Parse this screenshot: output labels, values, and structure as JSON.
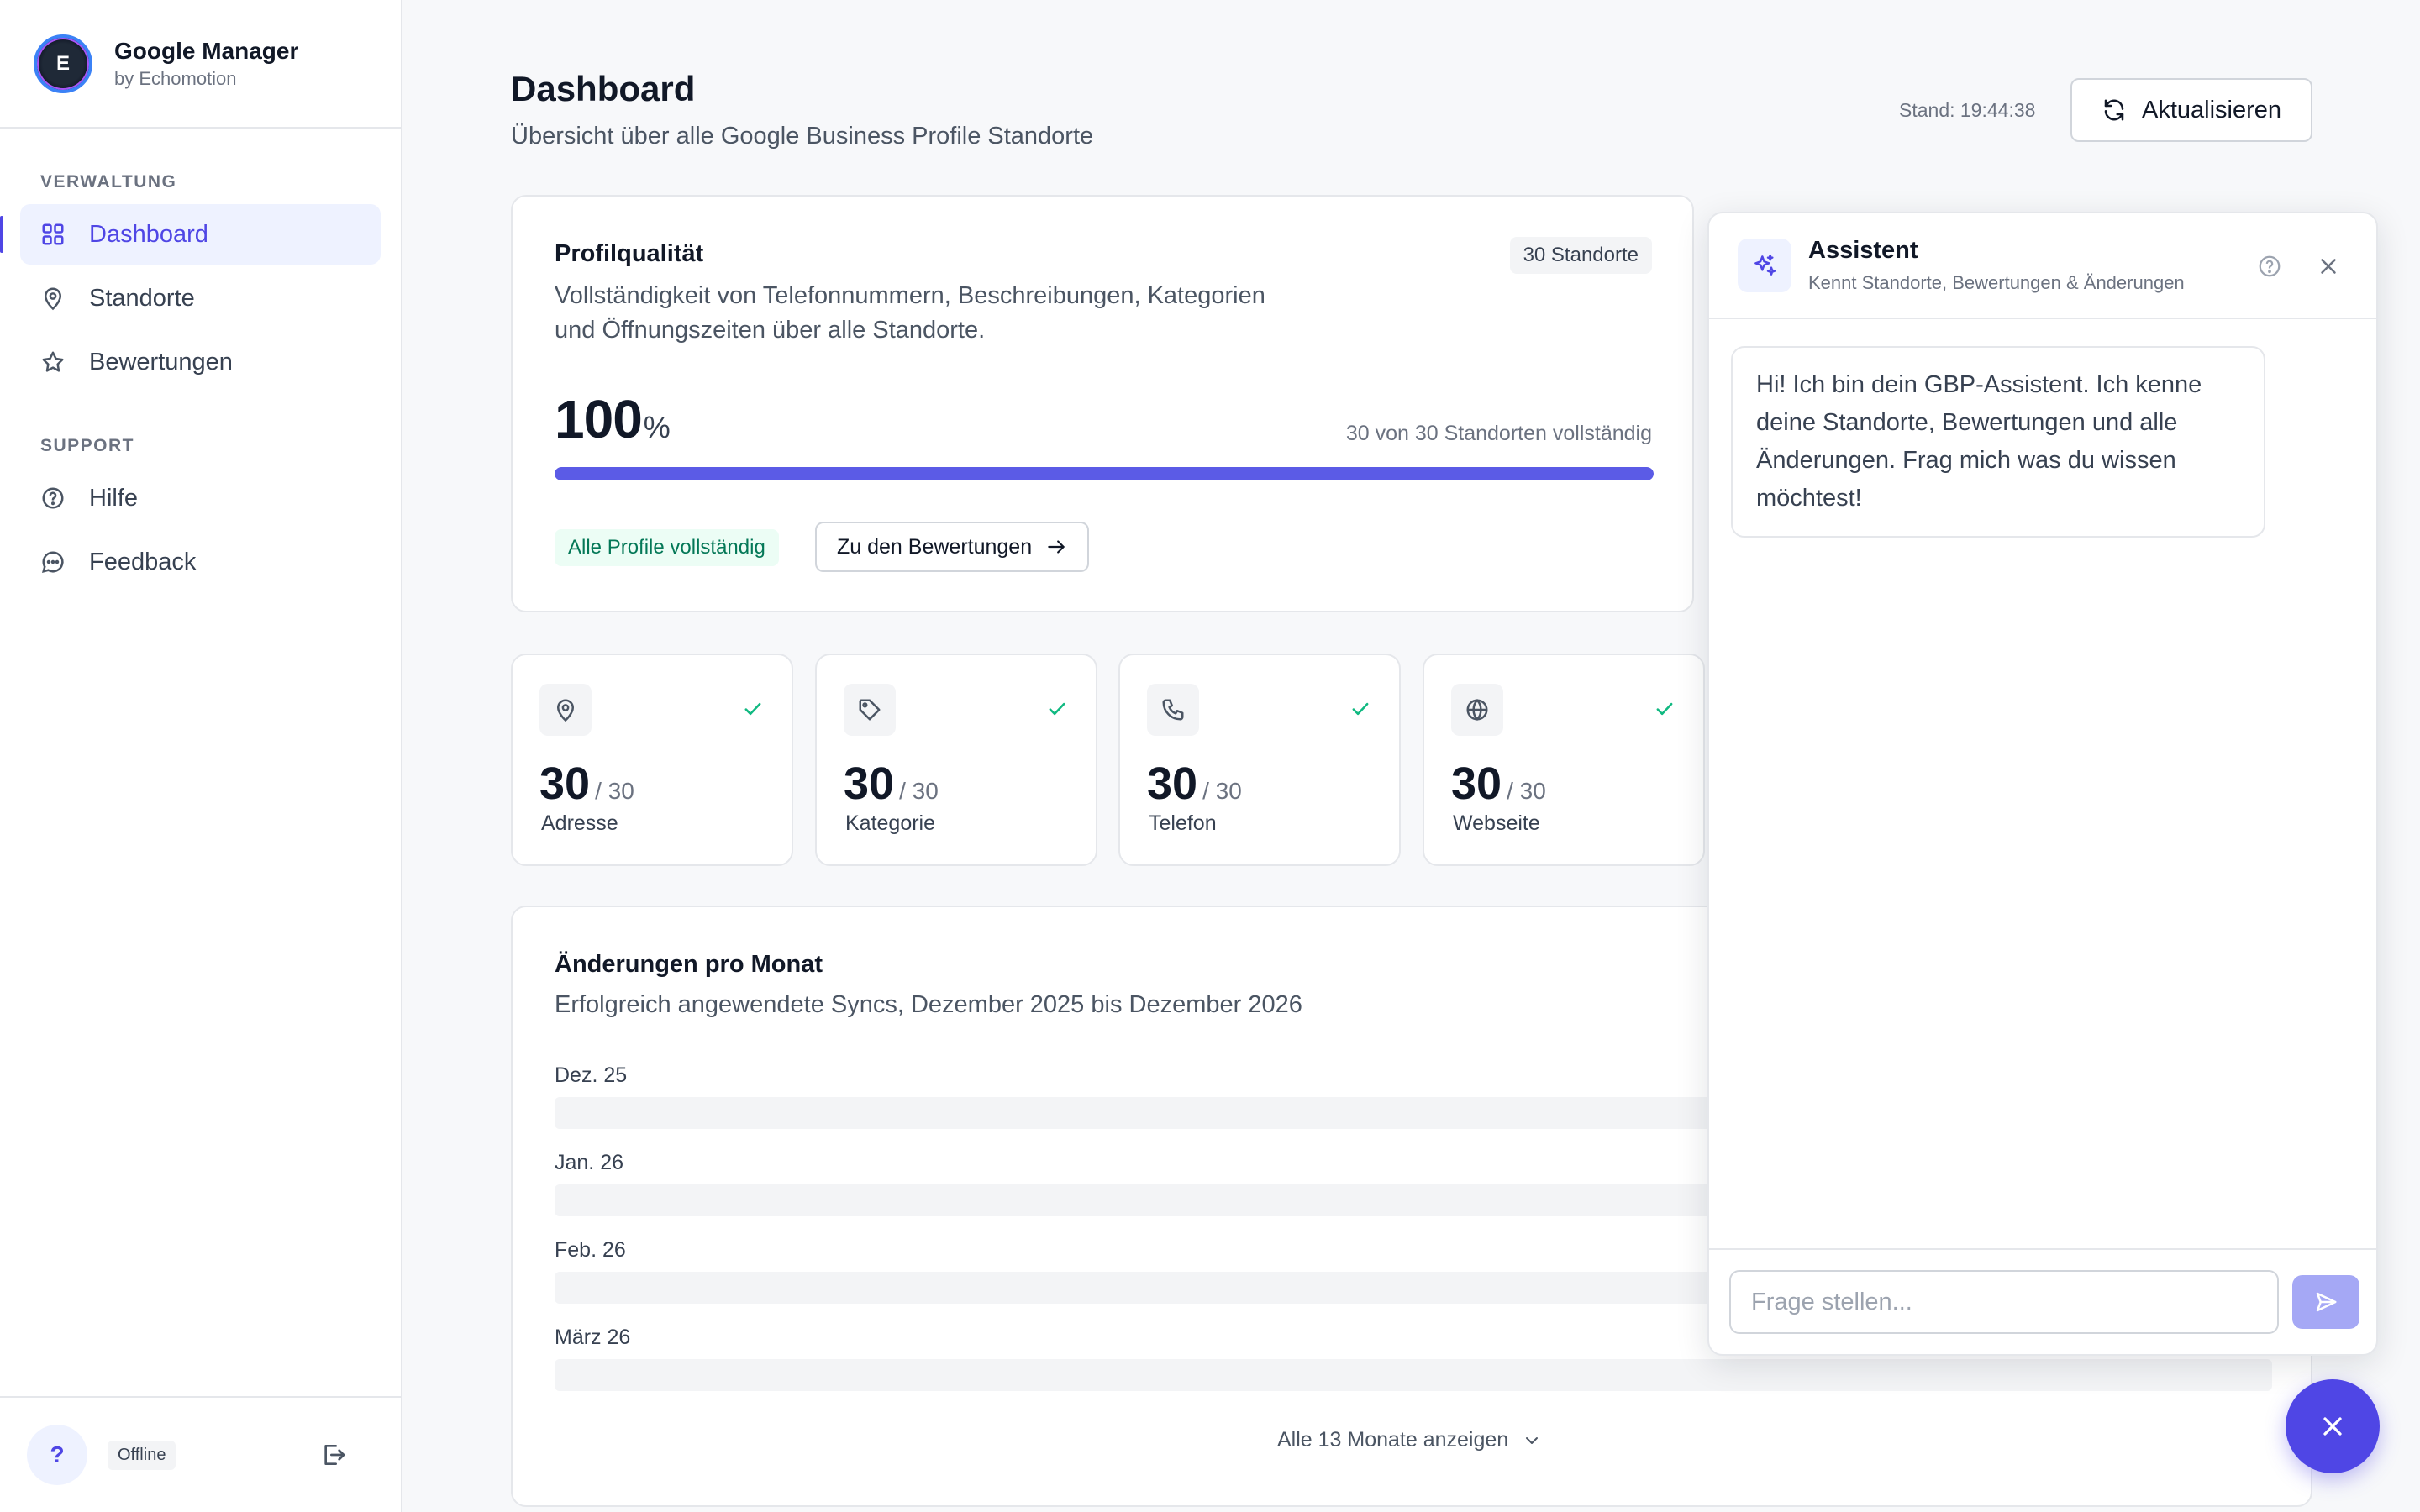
{
  "brand": {
    "title": "Google Manager",
    "subtitle": "by Echomotion",
    "logo_letter": "E"
  },
  "sidebar": {
    "sections": [
      {
        "heading": "VERWALTUNG",
        "items": [
          {
            "label": "Dashboard",
            "icon": "grid-icon",
            "active": true
          },
          {
            "label": "Standorte",
            "icon": "map-pin-icon"
          },
          {
            "label": "Bewertungen",
            "icon": "star-icon"
          }
        ]
      },
      {
        "heading": "SUPPORT",
        "items": [
          {
            "label": "Hilfe",
            "icon": "help-circle-icon"
          },
          {
            "label": "Feedback",
            "icon": "message-icon"
          }
        ]
      }
    ],
    "footer": {
      "help_glyph": "?",
      "status": "Offline"
    }
  },
  "header": {
    "title": "Dashboard",
    "subtitle": "Übersicht über alle Google Business Profile Standorte",
    "stand": "Stand: 19:44:38",
    "refresh_label": "Aktualisieren"
  },
  "profile_quality": {
    "title": "Profilqualität",
    "badge": "30 Standorte",
    "description": "Vollständigkeit von Telefonnummern, Beschreibungen, Kategorien und Öffnungszeiten über alle Standorte.",
    "percent": "100",
    "percent_unit": "%",
    "progress": 1.0,
    "count_text": "30 von 30 Standorten vollständig",
    "status_badge": "Alle Profile vollständig",
    "link_label": "Zu den Bewertungen"
  },
  "stats": [
    {
      "value": "30",
      "total": "/ 30",
      "label": "Adresse",
      "icon": "map-pin-icon"
    },
    {
      "value": "30",
      "total": "/ 30",
      "label": "Kategorie",
      "icon": "tag-icon"
    },
    {
      "value": "30",
      "total": "/ 30",
      "label": "Telefon",
      "icon": "phone-icon"
    },
    {
      "value": "30",
      "total": "/ 30",
      "label": "Webseite",
      "icon": "globe-icon"
    }
  ],
  "changes": {
    "title": "Änderungen pro Monat",
    "subtitle": "Erfolgreich angewendete Syncs, Dezember 2025 bis Dezember 2026",
    "months": [
      "Dez. 25",
      "Jan. 26",
      "Feb. 26",
      "März 26"
    ],
    "show_all": "Alle 13 Monate anzeigen"
  },
  "assistant": {
    "title": "Assistent",
    "subtitle": "Kennt Standorte, Bewertungen & Änderungen",
    "message": "Hi! Ich bin dein GBP-Assistent. Ich kenne deine Standorte, Bewertungen und alle Änderungen. Frag mich was du wissen möchtest!",
    "input_placeholder": "Frage stellen..."
  },
  "colors": {
    "accent": "#4f46e5",
    "progress": "#5b5be6",
    "success": "#047857",
    "send_disabled": "#a5a8f5"
  }
}
